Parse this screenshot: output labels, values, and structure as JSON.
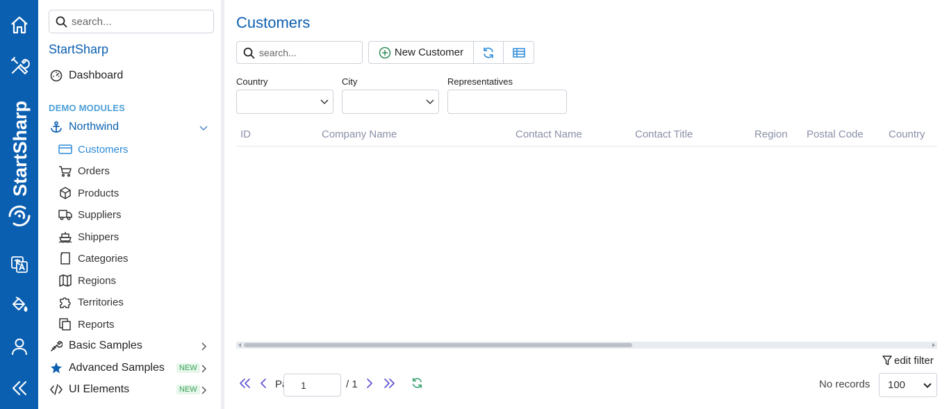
{
  "rail": {
    "brand_text": "StartSharp",
    "items": [
      {
        "icon": "home-icon"
      },
      {
        "icon": "tools-icon"
      },
      {
        "icon": "translate-icon"
      },
      {
        "icon": "paint-bucket-icon"
      },
      {
        "icon": "user-icon"
      },
      {
        "icon": "collapse-icon"
      }
    ]
  },
  "sidebar": {
    "search_placeholder": "search...",
    "title": "StartSharp",
    "dashboard": "Dashboard",
    "section": "DEMO MODULES",
    "northwind": "Northwind",
    "sub_items": [
      {
        "label": "Customers",
        "icon": "credit-card-icon"
      },
      {
        "label": "Orders",
        "icon": "cart-icon"
      },
      {
        "label": "Products",
        "icon": "box-icon"
      },
      {
        "label": "Suppliers",
        "icon": "truck-icon"
      },
      {
        "label": "Shippers",
        "icon": "ship-icon"
      },
      {
        "label": "Categories",
        "icon": "category-icon"
      },
      {
        "label": "Regions",
        "icon": "map-icon"
      },
      {
        "label": "Territories",
        "icon": "puzzle-icon"
      },
      {
        "label": "Reports",
        "icon": "reports-icon"
      }
    ],
    "basic_samples": "Basic Samples",
    "advanced_samples": "Advanced Samples",
    "ui_elements": "UI Elements",
    "new_badge": "NEW"
  },
  "main": {
    "title": "Customers",
    "search_placeholder": "search...",
    "new_customer": "New Customer",
    "filters": {
      "country": "Country",
      "city": "City",
      "representatives": "Representatives"
    },
    "columns": [
      "ID",
      "Company Name",
      "Contact Name",
      "Contact Title",
      "Region",
      "Postal Code",
      "Country"
    ],
    "edit_filter": "edit filter",
    "pager": {
      "page_label": "Page",
      "current": "1",
      "of": "/ 1",
      "status": "No records",
      "page_size": "100"
    }
  },
  "colors": {
    "brand": "#0b5fb0",
    "accent": "#2b8ad9",
    "muted": "#8a90a6"
  }
}
